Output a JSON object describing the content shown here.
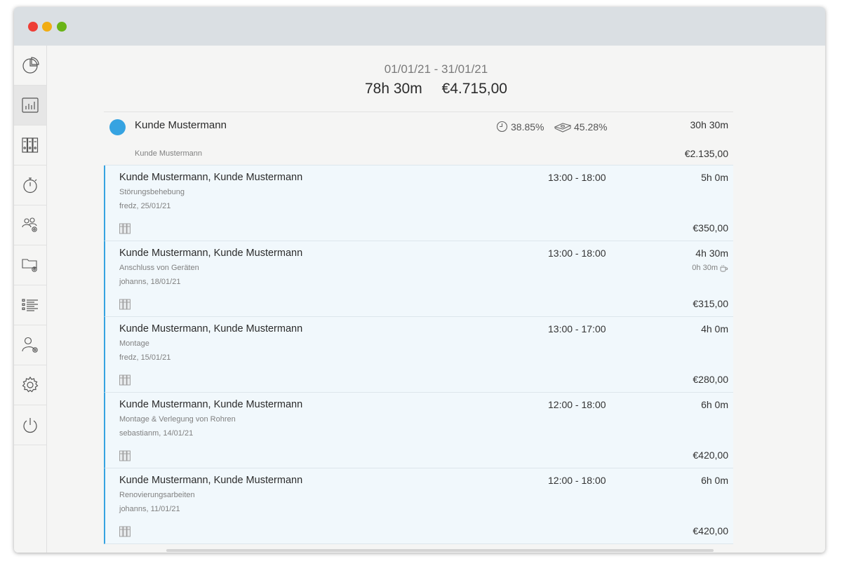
{
  "window": {
    "traffic_lights": [
      "close",
      "minimize",
      "zoom"
    ]
  },
  "sidebar": {
    "items": [
      {
        "icon": "pie-chart-icon",
        "active": false
      },
      {
        "icon": "bar-chart-icon",
        "active": true
      },
      {
        "icon": "binders-icon",
        "active": false
      },
      {
        "icon": "stopwatch-icon",
        "active": false
      },
      {
        "icon": "team-settings-icon",
        "active": false
      },
      {
        "icon": "folder-settings-icon",
        "active": false
      },
      {
        "icon": "list-icon",
        "active": false
      },
      {
        "icon": "user-settings-icon",
        "active": false
      },
      {
        "icon": "gear-icon",
        "active": false
      },
      {
        "icon": "power-icon",
        "active": false
      }
    ]
  },
  "report": {
    "date_range": "01/01/21 - 31/01/21",
    "total_hours": "78h 30m",
    "total_amount": "€4.715,00"
  },
  "client": {
    "name": "Kunde Mustermann",
    "sub_name": "Kunde Mustermann",
    "time_share": "38.85%",
    "money_share": "45.28%",
    "hours": "30h 30m",
    "amount": "€2.135,00",
    "color": "#36a3e1"
  },
  "entries": [
    {
      "title": "Kunde Mustermann, Kunde Mustermann",
      "description": "Störungsbehebung",
      "meta": "fredz, 25/01/21",
      "time": "13:00 - 18:00",
      "duration": "5h 0m",
      "break": "",
      "amount": "€350,00"
    },
    {
      "title": "Kunde Mustermann, Kunde Mustermann",
      "description": "Anschluss von Geräten",
      "meta": "johanns, 18/01/21",
      "time": "13:00 - 18:00",
      "duration": "4h 30m",
      "break": "0h 30m",
      "amount": "€315,00"
    },
    {
      "title": "Kunde Mustermann, Kunde Mustermann",
      "description": "Montage",
      "meta": "fredz, 15/01/21",
      "time": "13:00 - 17:00",
      "duration": "4h 0m",
      "break": "",
      "amount": "€280,00"
    },
    {
      "title": "Kunde Mustermann, Kunde Mustermann",
      "description": "Montage & Verlegung von Rohren",
      "meta": "sebastianm, 14/01/21",
      "time": "12:00 - 18:00",
      "duration": "6h 0m",
      "break": "",
      "amount": "€420,00"
    },
    {
      "title": "Kunde Mustermann, Kunde Mustermann",
      "description": "Renovierungsarbeiten",
      "meta": "johanns, 11/01/21",
      "time": "12:00 - 18:00",
      "duration": "6h 0m",
      "break": "",
      "amount": "€420,00"
    }
  ]
}
